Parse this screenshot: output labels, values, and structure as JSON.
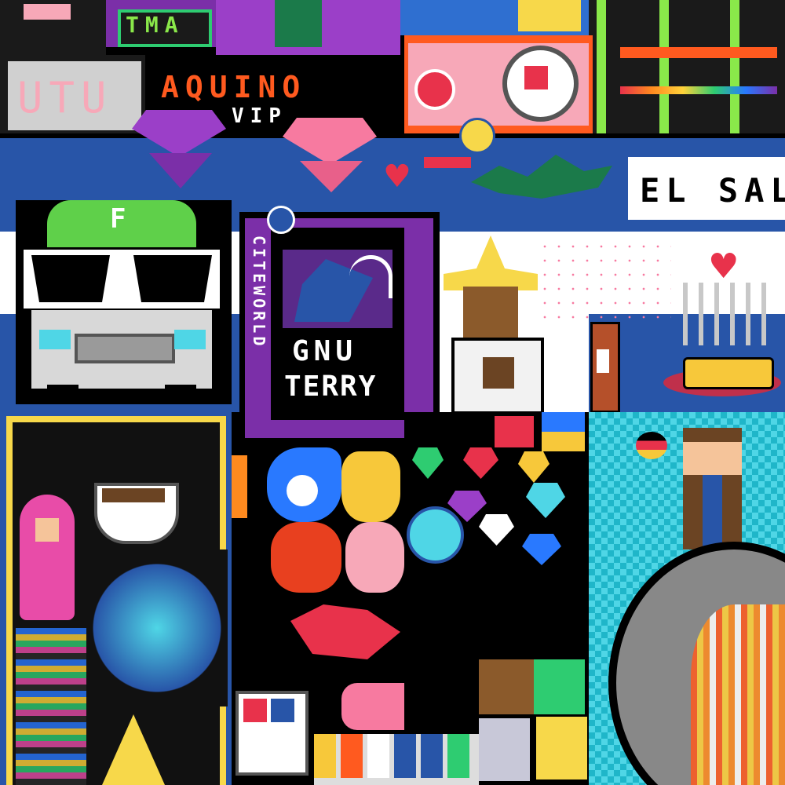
{
  "canvas": {
    "texts": {
      "tma": "TMA",
      "utu": "UTU",
      "aquino": "AQUINO",
      "vip": "VIP",
      "el_sal": "EL SAL",
      "f_letter": "F",
      "gnu": "GNU",
      "terry": "TERRY",
      "vertical_label": "CITEWORLD"
    },
    "colors": {
      "flag_blue": "#2855a8",
      "flag_white": "#ffffff",
      "purple": "#7b2fa8",
      "pink_panel": "#f7a8b8",
      "orange_text": "#ff5a1f",
      "cyan_check": "#4fd6e6",
      "green": "#8ae84a"
    },
    "icons": [
      "purple-gem-icon",
      "pink-gem-icon",
      "heart-icon",
      "sunglasses-truck-icon",
      "grim-reaper-icon",
      "witch-icon",
      "beer-bottle-icon",
      "coffee-cup-icon",
      "sonic-icon",
      "chaos-emerald-icon",
      "flag-globe-icon",
      "pixel-man-icon"
    ]
  }
}
